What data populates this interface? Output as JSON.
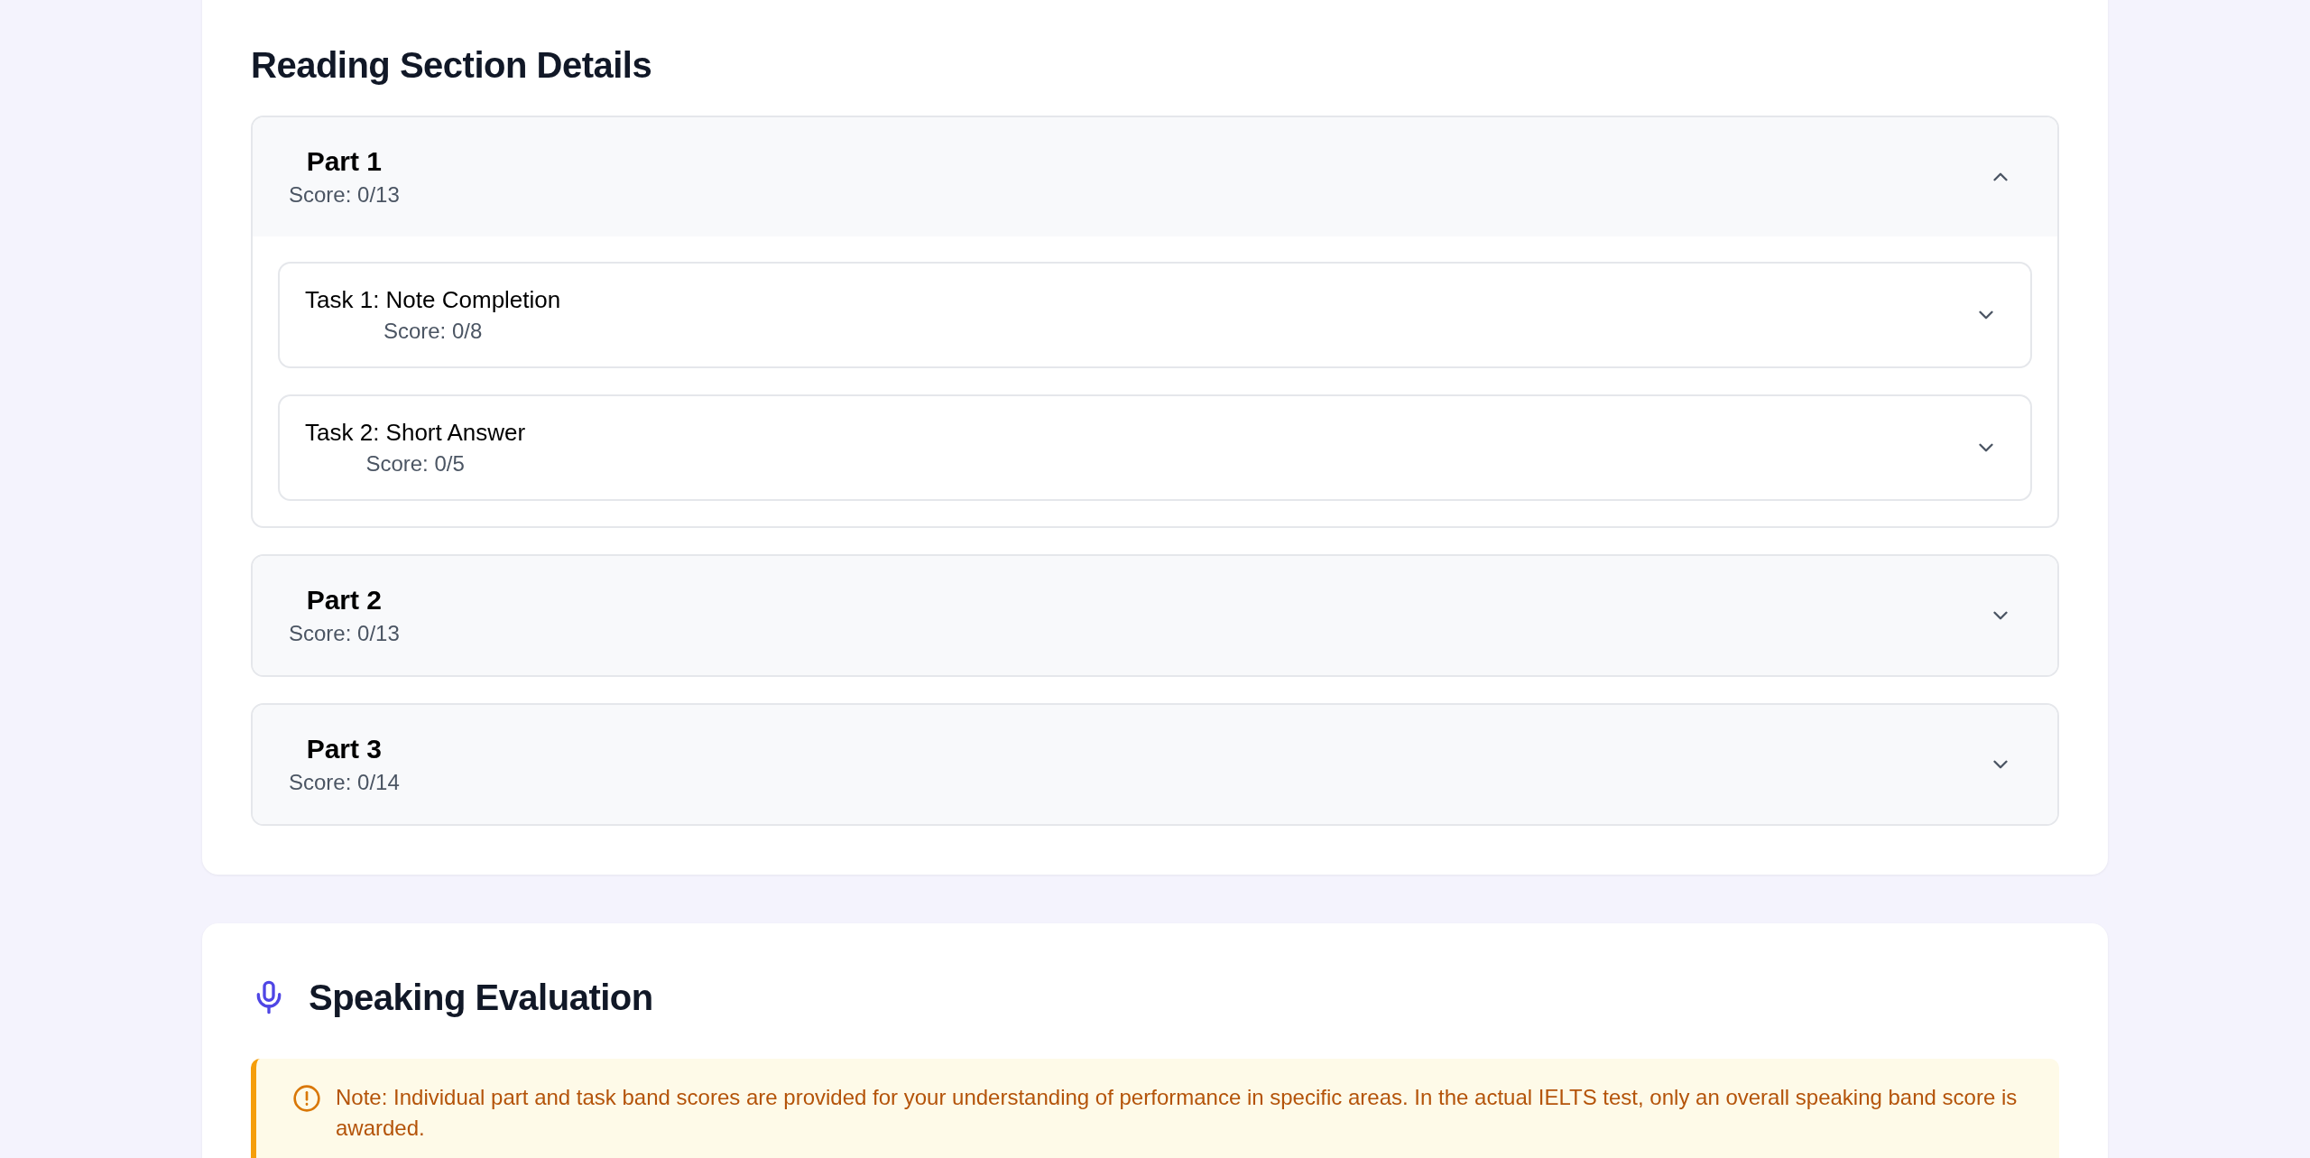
{
  "reading": {
    "title": "Reading Section Details",
    "parts": [
      {
        "title": "Part 1",
        "score": "Score: 0/13",
        "expanded": true,
        "tasks": [
          {
            "title": "Task 1: Note Completion",
            "score": "Score: 0/8",
            "expanded": false
          },
          {
            "title": "Task 2: Short Answer",
            "score": "Score: 0/5",
            "expanded": false
          }
        ]
      },
      {
        "title": "Part 2",
        "score": "Score: 0/13",
        "expanded": false
      },
      {
        "title": "Part 3",
        "score": "Score: 0/14",
        "expanded": false
      }
    ]
  },
  "speaking": {
    "title": "Speaking Evaluation",
    "note": "Note: Individual part and task band scores are provided for your understanding of performance in specific areas. In the actual IELTS test, only an overall speaking band score is awarded."
  }
}
